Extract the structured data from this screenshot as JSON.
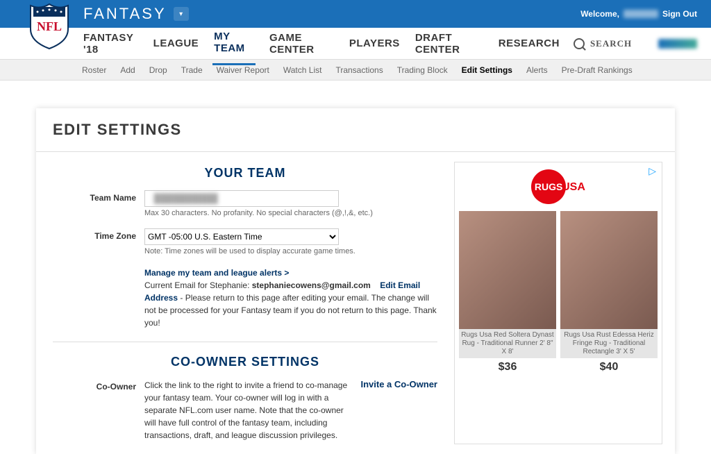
{
  "brand": "FANTASY",
  "welcome_prefix": "Welcome,",
  "signout": "Sign Out",
  "mainnav": [
    "FANTASY '18",
    "LEAGUE",
    "MY TEAM",
    "GAME CENTER",
    "PLAYERS",
    "DRAFT CENTER",
    "RESEARCH"
  ],
  "mainnav_active": 2,
  "search_label": "SEARCH",
  "subnav": [
    "Roster",
    "Add",
    "Drop",
    "Trade",
    "Waiver Report",
    "Watch List",
    "Transactions",
    "Trading Block",
    "Edit Settings",
    "Alerts",
    "Pre-Draft Rankings"
  ],
  "subnav_active": 8,
  "page_title": "EDIT SETTINGS",
  "sec_team": "YOUR TEAM",
  "labels": {
    "team_name": "Team Name",
    "time_zone": "Time Zone",
    "co_owner": "Co-Owner"
  },
  "team_name_hint": "Max 30 characters. No profanity. No special characters (@,!,&, etc.)",
  "time_zone_value": "GMT -05:00 U.S. Eastern Time",
  "time_zone_hint": "Note: Time zones will be used to display accurate game times.",
  "alerts_link": "Manage my team and league alerts >",
  "email_line_prefix": "Current Email for Stephanie: ",
  "email_value": "stephaniecowens@gmail.com",
  "edit_email": "Edit Email Address",
  "email_note": " - Please return to this page after editing your email. The change will not be processed for your Fantasy team if you do not return to this page. Thank you!",
  "sec_co": "CO-OWNER SETTINGS",
  "co_owner_text": "Click the link to the right to invite a friend to co-manage your fantasy team. Your co-owner will log in with a separate NFL.com user name. Note that the co-owner will have full control of the fantasy team, including transactions, draft, and league discussion privileges.",
  "invite_link": "Invite a Co-Owner",
  "ad": {
    "brand1": "RUGS",
    "brand2": "USA",
    "items": [
      {
        "title": "Rugs Usa Red Soltera Dynast Rug - Traditional Runner 2' 8\" X 8'",
        "price": "$36"
      },
      {
        "title": "Rugs Usa Rust Edessa Heriz Fringe Rug - Traditional Rectangle 3' X 5'",
        "price": "$40"
      }
    ]
  }
}
